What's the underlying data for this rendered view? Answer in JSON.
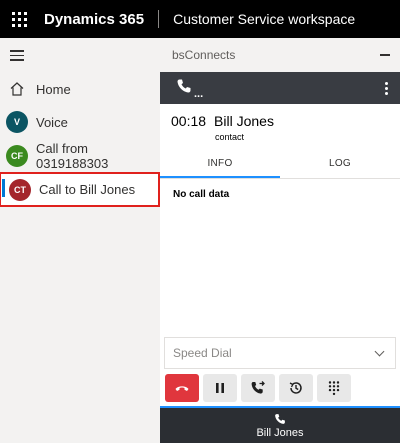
{
  "header": {
    "app_name": "Dynamics 365",
    "workspace": "Customer Service workspace"
  },
  "sidebar": {
    "items": [
      {
        "label": "Home",
        "icon": "home-icon"
      },
      {
        "label": "Voice",
        "avatar": "V",
        "color": "#0b5563"
      },
      {
        "label": "Call from 0319188303",
        "avatar": "CF",
        "color": "#3b8a1f"
      },
      {
        "label": "Call to Bill Jones",
        "avatar": "CT",
        "color": "#a4262c",
        "selected": true
      }
    ]
  },
  "panel": {
    "title": "bsConnects",
    "call": {
      "timer": "00:18",
      "name": "Bill Jones",
      "type": "contact"
    },
    "tabs": [
      {
        "label": "INFO",
        "active": true
      },
      {
        "label": "LOG",
        "active": false
      }
    ],
    "info_text": "No call data",
    "speed_dial_placeholder": "Speed Dial",
    "active_call_name": "Bill Jones",
    "colors": {
      "hangup": "#e0363d",
      "accent": "#1e90ff",
      "toolbar": "#393c42"
    }
  }
}
